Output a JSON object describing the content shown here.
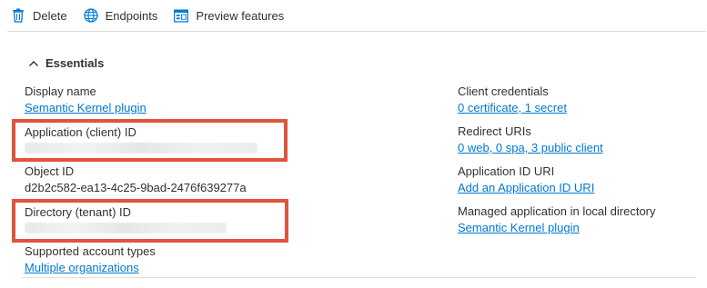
{
  "toolbar": {
    "delete_label": "Delete",
    "endpoints_label": "Endpoints",
    "preview_label": "Preview features"
  },
  "essentials": {
    "title": "Essentials"
  },
  "left": {
    "display_name_label": "Display name",
    "display_name_value": "Semantic Kernel plugin",
    "app_id_label": "Application (client) ID",
    "object_id_label": "Object ID",
    "object_id_value": "d2b2c582-ea13-4c25-9bad-2476f639277a",
    "tenant_id_label": "Directory (tenant) ID",
    "account_types_label": "Supported account types",
    "account_types_value": "Multiple organizations"
  },
  "right": {
    "client_credentials_label": "Client credentials",
    "client_credentials_value": "0 certificate, 1 secret",
    "redirect_uris_label": "Redirect URIs",
    "redirect_uris_value": "0 web, 0 spa, 3 public client",
    "app_id_uri_label": "Application ID URI",
    "app_id_uri_value": "Add an Application ID URI",
    "managed_app_label": "Managed application in local directory",
    "managed_app_value": "Semantic Kernel plugin"
  },
  "colors": {
    "link": "#0078d4",
    "highlight": "#e0533d",
    "text": "#323130"
  },
  "icons": {
    "delete": "trash-icon",
    "endpoints": "globe-icon",
    "preview": "preview-features-icon",
    "collapse": "chevron-up-icon"
  }
}
